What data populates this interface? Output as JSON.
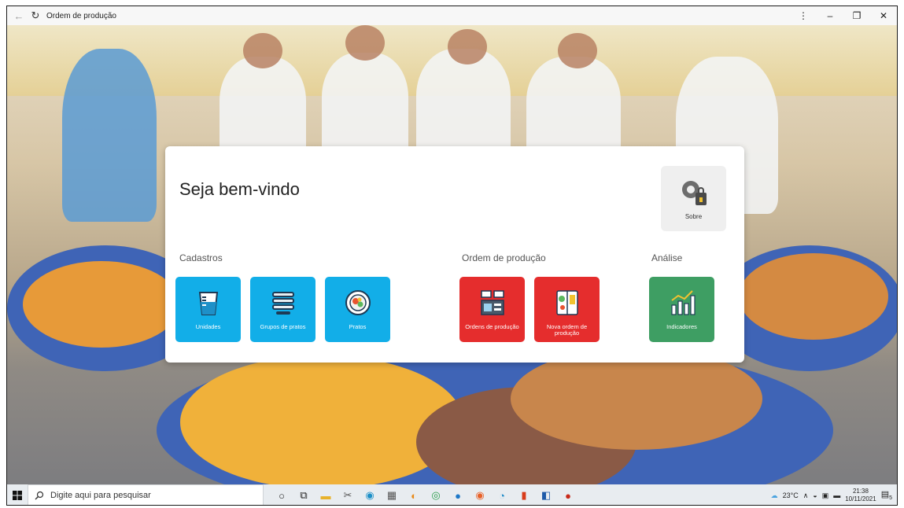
{
  "window": {
    "title": "Ordem de produção",
    "back_glyph": "←",
    "refresh_glyph": "↻",
    "menu_glyph": "⋮",
    "minimize_glyph": "–",
    "restore_glyph": "❐",
    "close_glyph": "✕"
  },
  "card": {
    "welcome": "Seja bem-vindo",
    "sobre_label": "Sobre",
    "sections": {
      "cadastros": "Cadastros",
      "ordem": "Ordem de produção",
      "analise": "Análise"
    },
    "tiles": {
      "unidades": "Unidades",
      "grupos": "Grupos de pratos",
      "pratos": "Pratos",
      "ordens": "Ordens de produção",
      "nova": "Nova ordem de produção",
      "indicadores": "Indicadores"
    }
  },
  "colors": {
    "blue": "#12aee8",
    "red": "#e52d2d",
    "green": "#3e9e63"
  },
  "taskbar": {
    "search_placeholder": "Digite aqui para pesquisar",
    "temperature": "23°C",
    "time": "21:38",
    "date": "10/11/2021",
    "notifications": "5"
  }
}
